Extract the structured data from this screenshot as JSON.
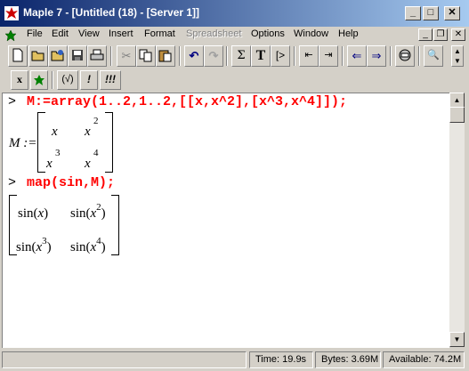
{
  "window": {
    "title": "Maple 7  - [Untitled (18) - [Server 1]]"
  },
  "menu": {
    "items": [
      "File",
      "Edit",
      "View",
      "Insert",
      "Format",
      "Spreadsheet",
      "Options",
      "Window",
      "Help"
    ],
    "disabled": [
      "Spreadsheet"
    ]
  },
  "toolbar2": {
    "x_label": "x",
    "paren_label": "(√)",
    "bang_label": "!",
    "bangs_label": "!!!"
  },
  "worksheet": {
    "prompt": ">",
    "input1": "M:=array(1..2,1..2,[[x,x^2],[x^3,x^4]]);",
    "output1_lhs": "M :=",
    "matrix1": [
      [
        "x",
        "x",
        "2"
      ],
      [
        "x",
        "3",
        "x",
        "4"
      ]
    ],
    "input2": "map(sin,M);",
    "matrix2": {
      "r1c1": "sin(x)",
      "r1c2_pre": "sin(x",
      "r1c2_exp": "2",
      "r1c2_post": ")",
      "r2c1_pre": "sin(x",
      "r2c1_exp": "3",
      "r2c1_post": ")",
      "r2c2_pre": "sin(x",
      "r2c2_exp": "4",
      "r2c2_post": ")"
    }
  },
  "status": {
    "time": "Time:  19.9s",
    "bytes": "Bytes: 3.69M",
    "available": "Available: 74.2M"
  },
  "colors": {
    "titlebar": "#0a246a",
    "command": "#ff0000",
    "chrome": "#d4d0c8"
  }
}
